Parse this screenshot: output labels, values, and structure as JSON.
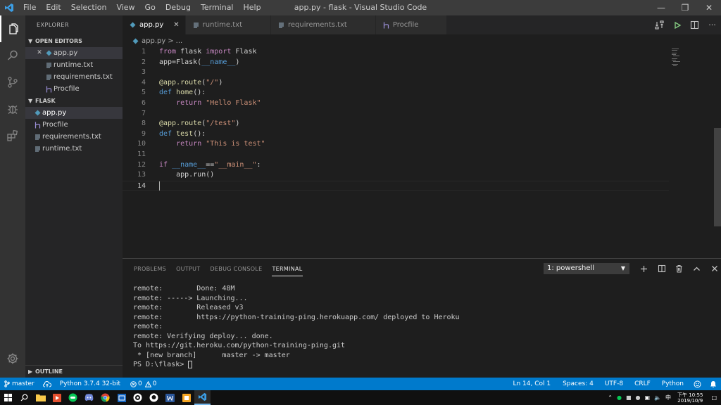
{
  "window": {
    "title": "app.py - flask - Visual Studio Code",
    "menu": [
      "File",
      "Edit",
      "Selection",
      "View",
      "Go",
      "Debug",
      "Terminal",
      "Help"
    ]
  },
  "sidebar": {
    "title": "EXPLORER",
    "open_editors_label": "OPEN EDITORS",
    "open_editors": [
      {
        "name": "app.py",
        "icon": "python-file-icon"
      },
      {
        "name": "runtime.txt",
        "icon": "text-file-icon"
      },
      {
        "name": "requirements.txt",
        "icon": "text-file-icon"
      },
      {
        "name": "Procfile",
        "icon": "heroku-icon"
      }
    ],
    "folder_label": "FLASK",
    "files": [
      {
        "name": "app.py",
        "icon": "python-file-icon"
      },
      {
        "name": "Procfile",
        "icon": "heroku-icon"
      },
      {
        "name": "requirements.txt",
        "icon": "text-file-icon"
      },
      {
        "name": "runtime.txt",
        "icon": "text-file-icon"
      }
    ],
    "outline_label": "OUTLINE"
  },
  "tabs": [
    {
      "label": "app.py",
      "icon": "python-file-icon",
      "active": true
    },
    {
      "label": "runtime.txt",
      "icon": "text-file-icon",
      "active": false
    },
    {
      "label": "requirements.txt",
      "icon": "text-file-icon",
      "active": false
    },
    {
      "label": "Procfile",
      "icon": "heroku-icon",
      "active": false
    }
  ],
  "breadcrumb": {
    "file": "app.py",
    "separator": ">",
    "rest": "..."
  },
  "editor": {
    "current_line": 14,
    "lines": [
      {
        "n": "1",
        "t": [
          [
            "kw",
            "from"
          ],
          [
            "p",
            " flask "
          ],
          [
            "kw",
            "import"
          ],
          [
            "p",
            " Flask"
          ]
        ]
      },
      {
        "n": "2",
        "t": [
          [
            "p",
            "app=Flask("
          ],
          [
            "dunder",
            "__name__"
          ],
          [
            "p",
            ")"
          ]
        ]
      },
      {
        "n": "3",
        "t": []
      },
      {
        "n": "4",
        "t": [
          [
            "fn",
            "@app.route"
          ],
          [
            "p",
            "("
          ],
          [
            "str",
            "\"/\""
          ],
          [
            "p",
            ")"
          ]
        ]
      },
      {
        "n": "5",
        "t": [
          [
            "def",
            "def"
          ],
          [
            "p",
            " "
          ],
          [
            "fn",
            "home"
          ],
          [
            "p",
            "():"
          ]
        ]
      },
      {
        "n": "6",
        "t": [
          [
            "p",
            "    "
          ],
          [
            "kw",
            "return"
          ],
          [
            "p",
            " "
          ],
          [
            "str",
            "\"Hello Flask\""
          ]
        ]
      },
      {
        "n": "7",
        "t": []
      },
      {
        "n": "8",
        "t": [
          [
            "fn",
            "@app.route"
          ],
          [
            "p",
            "("
          ],
          [
            "str",
            "\"/test\""
          ],
          [
            "p",
            ")"
          ]
        ]
      },
      {
        "n": "9",
        "t": [
          [
            "def",
            "def"
          ],
          [
            "p",
            " "
          ],
          [
            "fn",
            "test"
          ],
          [
            "p",
            "():"
          ]
        ]
      },
      {
        "n": "10",
        "t": [
          [
            "p",
            "    "
          ],
          [
            "kw",
            "return"
          ],
          [
            "p",
            " "
          ],
          [
            "str",
            "\"This is test\""
          ]
        ]
      },
      {
        "n": "11",
        "t": []
      },
      {
        "n": "12",
        "t": [
          [
            "kw",
            "if"
          ],
          [
            "p",
            " "
          ],
          [
            "dunder",
            "__name__"
          ],
          [
            "p",
            "=="
          ],
          [
            "str",
            "\"__main__\""
          ],
          [
            "p",
            ":"
          ]
        ]
      },
      {
        "n": "13",
        "t": [
          [
            "p",
            "    app.run()"
          ]
        ]
      },
      {
        "n": "14",
        "t": []
      }
    ]
  },
  "panel": {
    "tabs": [
      "PROBLEMS",
      "OUTPUT",
      "DEBUG CONSOLE",
      "TERMINAL"
    ],
    "active_tab": "TERMINAL",
    "terminal_select": "1: powershell",
    "terminal_lines": [
      "remote:        Done: 48M",
      "remote: -----> Launching...",
      "remote:        Released v3",
      "remote:        https://python-training-ping.herokuapp.com/ deployed to Heroku",
      "remote:",
      "remote: Verifying deploy... done.",
      "To https://git.heroku.com/python-training-ping.git",
      " * [new branch]      master -> master"
    ],
    "prompt": "PS D:\\flask> "
  },
  "status": {
    "branch": "master",
    "interpreter": "Python 3.7.4 32-bit",
    "errors": "0",
    "warnings": "0",
    "position": "Ln 14, Col 1",
    "spaces": "Spaces: 4",
    "encoding": "UTF-8",
    "eol": "CRLF",
    "language": "Python"
  },
  "taskbar": {
    "time": "下午 10:55",
    "date": "2019/10/9",
    "ime": "中"
  },
  "colors": {
    "accent": "#007acc",
    "keyword": "#c586c0",
    "def_keyword": "#569cd6",
    "function": "#dcdcaa",
    "string": "#ce9178"
  }
}
